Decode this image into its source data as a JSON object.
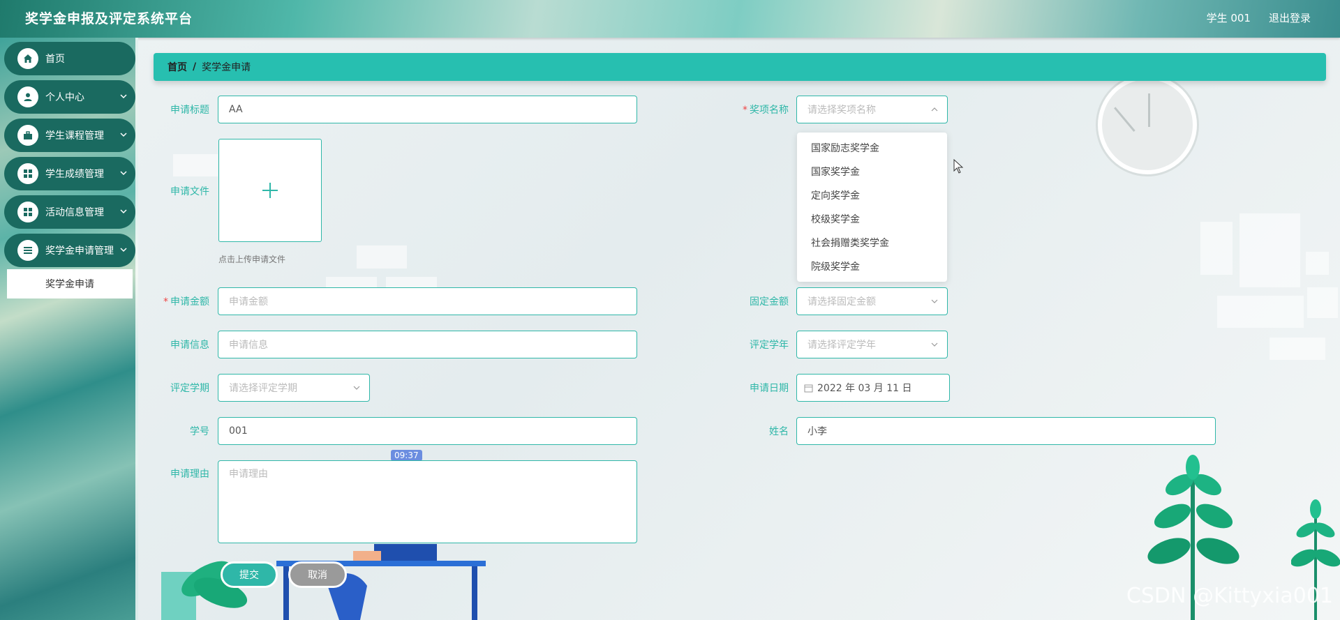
{
  "header": {
    "title": "奖学金申报及评定系统平台",
    "user": "学生 001",
    "logout": "退出登录"
  },
  "sidebar": {
    "items": [
      {
        "label": "首页",
        "icon": "home-icon"
      },
      {
        "label": "个人中心",
        "icon": "user-icon"
      },
      {
        "label": "学生课程管理",
        "icon": "briefcase-icon"
      },
      {
        "label": "学生成绩管理",
        "icon": "grid-icon"
      },
      {
        "label": "活动信息管理",
        "icon": "grid-icon"
      },
      {
        "label": "奖学金申请管理",
        "icon": "list-icon"
      }
    ],
    "active_sub": "奖学金申请"
  },
  "breadcrumb": {
    "home": "首页",
    "sep": "/",
    "current": "奖学金申请"
  },
  "form": {
    "title": {
      "label": "申请标题",
      "value": "AA"
    },
    "award": {
      "label": "奖项名称",
      "placeholder": "请选择奖项名称"
    },
    "file": {
      "label": "申请文件",
      "tip": "点击上传申请文件"
    },
    "amount": {
      "label": "申请金额",
      "placeholder": "申请金额"
    },
    "fixed_amount": {
      "label": "固定金额",
      "placeholder": "请选择固定金额"
    },
    "info": {
      "label": "申请信息",
      "placeholder": "申请信息"
    },
    "year": {
      "label": "评定学年",
      "placeholder": "请选择评定学年"
    },
    "term": {
      "label": "评定学期",
      "placeholder": "请选择评定学期"
    },
    "date": {
      "label": "申请日期",
      "value": "2022 年 03 月 11 日"
    },
    "student_no": {
      "label": "学号",
      "value": "001"
    },
    "name": {
      "label": "姓名",
      "value": "小李"
    },
    "reason": {
      "label": "申请理由",
      "placeholder": "申请理由"
    }
  },
  "award_options": [
    "国家励志奖学金",
    "国家奖学金",
    "定向奖学金",
    "校级奖学金",
    "社会捐赠类奖学金",
    "院级奖学金"
  ],
  "buttons": {
    "submit": "提交",
    "cancel": "取消"
  },
  "overlay": {
    "time": "09:37",
    "watermark": "CSDN @Kittyxia001"
  },
  "colors": {
    "accent": "#2fb7a8",
    "sidebar_item": "#1a6a60",
    "required": "#e44444"
  }
}
